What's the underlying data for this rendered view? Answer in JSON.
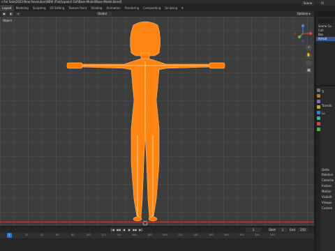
{
  "title": "s For Sale\\2023 New Revolution\\NEW (Flat)\\npatch Girl\\Base Model\\Base Model.blend]",
  "workspace_tabs": [
    "Layout",
    "Modeling",
    "Sculpting",
    "UV Editing",
    "Texture Paint",
    "Shading",
    "Animation",
    "Rendering",
    "Compositing",
    "Scripting"
  ],
  "active_tab": "Layout",
  "add_tab": "+",
  "scene": "Scene",
  "view_layer": "Vi",
  "viewport": {
    "label": "Object",
    "transform_orientation": "Global",
    "options": "Options ▾",
    "model_color": "#ff7a00",
    "nav_buttons": [
      "⌕",
      "✋",
      "🎥",
      "▦"
    ]
  },
  "outliner": {
    "rows": [
      "Scene Co",
      "Coll",
      "Bas",
      "Armat"
    ]
  },
  "properties": {
    "rows": [
      "Tr",
      "Transfo",
      "Lo",
      "Delta",
      "Relation",
      "Collectio",
      "Instanc",
      "Motion",
      "Visibilit",
      "Viewpo",
      "Custom"
    ]
  },
  "timeline": {
    "current_frame": "1",
    "start_label": "Start",
    "start_value": "1",
    "end_label": "End",
    "end_value": "250",
    "controls": [
      "|◀",
      "◀◀",
      "◀",
      "▶",
      "▶▶",
      "▶|"
    ],
    "ticks": [
      "0",
      "20",
      "40",
      "60",
      "80",
      "100",
      "120",
      "140",
      "160",
      "180",
      "200",
      "220",
      "240",
      "260",
      "280",
      "300",
      "320",
      "340"
    ],
    "playhead_frame": "1"
  }
}
